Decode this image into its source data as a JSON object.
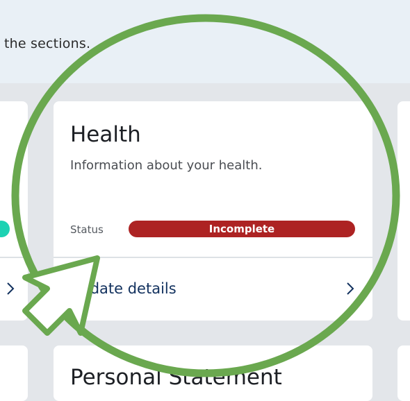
{
  "banner": {
    "text": "the sections."
  },
  "cards": {
    "main": {
      "title": "Health",
      "description": "Information about your health.",
      "status_label": "Status",
      "status_value": "Incomplete",
      "action_label": "Update details"
    },
    "bottom": {
      "title": "Personal Statement"
    }
  },
  "colors": {
    "status_incomplete": "#ad2323",
    "status_complete": "#1dd2b3",
    "highlight": "#6aa84f",
    "link": "#12315e"
  },
  "icons": {
    "action_chevron": "chevron-right-icon",
    "highlight": "highlight-circle",
    "pointer": "pointer-arrow"
  }
}
